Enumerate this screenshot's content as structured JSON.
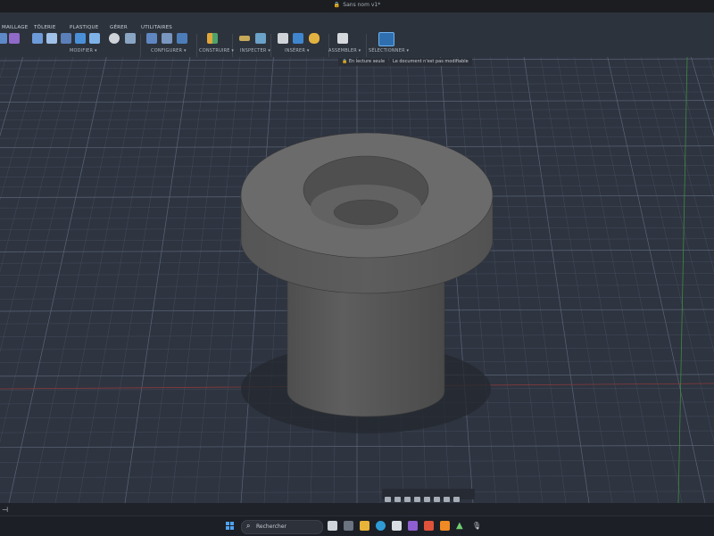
{
  "window": {
    "doc_title": "Sans nom v1*"
  },
  "toolbar": {
    "tabs": [
      "MAILLAGE",
      "TÔLERIE",
      "PLASTIQUE",
      "GÉRER",
      "UTILITAIRES"
    ],
    "groups": [
      "MODIFIER ▾",
      "CONFIGURER ▾",
      "CONSTRUIRE ▾",
      "INSPECTER ▾",
      "INSÉRER ▾",
      "ASSEMBLER ▾",
      "SÉLECTIONNER ▾"
    ]
  },
  "readonly_bar": {
    "lock_label": "En lecture seule",
    "message": "Le document n'est pas modifiable"
  },
  "taskbar": {
    "search_placeholder": "Rechercher"
  },
  "colors": {
    "viewport_bg": "#2e3440",
    "grid_minor": "#4a5262",
    "grid_major": "#5c6577",
    "axis_red": "#8b3a3a",
    "axis_green": "#3f8a3f",
    "model_face": "#6b6b6b",
    "model_side": "#575757",
    "toolbar_bg": "#2d333c",
    "accent_blue": "#4fa3f0"
  },
  "icons": {
    "lock": "lock-icon",
    "windows": "windows-logo-icon",
    "search": "search-icon",
    "select": "select-cursor-icon"
  }
}
